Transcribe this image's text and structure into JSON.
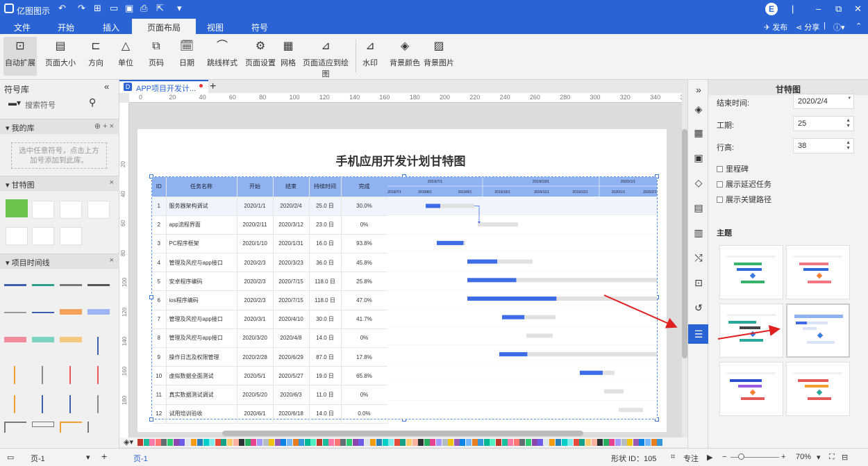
{
  "app": {
    "name": "亿图图示",
    "user_initial": "E",
    "publish": "发布",
    "share": "分享",
    "help": "?"
  },
  "menu": {
    "items": [
      "文件",
      "开始",
      "插入",
      "页面布局",
      "视图",
      "符号"
    ],
    "active": "页面布局"
  },
  "ribbon": {
    "buttons": [
      "自动扩展",
      "页面大小",
      "方向",
      "单位",
      "页码",
      "日期",
      "跳线样式",
      "页面设置",
      "网格",
      "页面适应到绘图",
      "水印",
      "背景颜色",
      "背景图片"
    ]
  },
  "left_panel": {
    "title": "符号库",
    "search_placeholder": "搜索符号",
    "sections": {
      "my_lib": "我的库",
      "gantt": "甘特图",
      "timeline": "项目时间线"
    },
    "my_lib_hint": "选中任意符号，点击上方加号添加到此库。"
  },
  "doc_tab": {
    "name": "APP项目开发计..."
  },
  "ruler": {
    "h": [
      "0",
      "20",
      "40",
      "60",
      "80",
      "100",
      "120",
      "140",
      "160",
      "180",
      "200",
      "220",
      "240",
      "260",
      "280",
      "300",
      "320",
      "340",
      "36"
    ],
    "v": [
      "20",
      "40",
      "60",
      "80",
      "100",
      "120",
      "140",
      "160",
      "180"
    ]
  },
  "chart": {
    "title": "手机应用开发计划甘特图",
    "headers": [
      "ID",
      "任务名称",
      "开始",
      "结束",
      "持续时间",
      "完成"
    ],
    "timeline_top": [
      "2019/7/1",
      "2019/10/1",
      "2020/1/1"
    ],
    "timeline_bottom": [
      "2019/7/1",
      "2019/8/1",
      "2019/9/1",
      "2019/10/1",
      "2019/11/1",
      "2019/12/1",
      "2020/1/1",
      "2020/2/1"
    ],
    "rows": [
      {
        "id": "1",
        "name": "服务器架构调试",
        "start": "2020/1/1",
        "end": "2020/2/4",
        "dur": "25.0 日",
        "done": "30.0%"
      },
      {
        "id": "2",
        "name": "app流程界面",
        "start": "2020/2/11",
        "end": "2020/3/12",
        "dur": "23.0 日",
        "done": "0%"
      },
      {
        "id": "3",
        "name": "PC程序框架",
        "start": "2020/1/10",
        "end": "2020/1/31",
        "dur": "16.0 日",
        "done": "93.8%"
      },
      {
        "id": "4",
        "name": "管理及风控与app接口",
        "start": "2020/2/3",
        "end": "2020/3/23",
        "dur": "36.0 日",
        "done": "45.8%"
      },
      {
        "id": "5",
        "name": "安卓程序编码",
        "start": "2020/2/3",
        "end": "2020/7/15",
        "dur": "118.0 日",
        "done": "25.8%"
      },
      {
        "id": "6",
        "name": "ios程序编码",
        "start": "2020/2/3",
        "end": "2020/7/15",
        "dur": "118.0 日",
        "done": "47.0%"
      },
      {
        "id": "7",
        "name": "管理及风控与app接口",
        "start": "2020/3/1",
        "end": "2020/4/10",
        "dur": "30.0 日",
        "done": "41.7%"
      },
      {
        "id": "8",
        "name": "管理及风控与app接口",
        "start": "2020/3/20",
        "end": "2020/4/8",
        "dur": "14.0 日",
        "done": "0%"
      },
      {
        "id": "9",
        "name": "操作日志及权限管理",
        "start": "2020/2/28",
        "end": "2020/6/29",
        "dur": "87.0 日",
        "done": "17.8%"
      },
      {
        "id": "10",
        "name": "虚拟数据全面测试",
        "start": "2020/5/1",
        "end": "2020/5/27",
        "dur": "19.0 日",
        "done": "65.8%"
      },
      {
        "id": "11",
        "name": "真实数据测试调试",
        "start": "2020/5/20",
        "end": "2020/6/3",
        "dur": "11.0 日",
        "done": "0%"
      },
      {
        "id": "12",
        "name": "试用培训验收",
        "start": "2020/6/1",
        "end": "2020/6/18",
        "dur": "14.0 日",
        "done": "0.0%"
      }
    ]
  },
  "right_panel": {
    "title": "甘特图",
    "end_time_label": "结束时间:",
    "end_time": "2020/2/4",
    "duration_label": "工期:",
    "duration": "25",
    "row_height_label": "行高:",
    "row_height": "38",
    "milestone": "里程碑",
    "show_delay": "展示延迟任务",
    "show_critical": "展示关键路径",
    "theme_label": "主题"
  },
  "status": {
    "page_select": "页-1",
    "page_tab": "页-1",
    "shape_id": "形状 ID：105",
    "focus": "专注",
    "zoom": "70%"
  },
  "colors": {
    "accent": "#2a64d4",
    "bar_done": "#3e6be6",
    "bar_rest": "#e1e1e1",
    "header": "#8fb3f0"
  }
}
